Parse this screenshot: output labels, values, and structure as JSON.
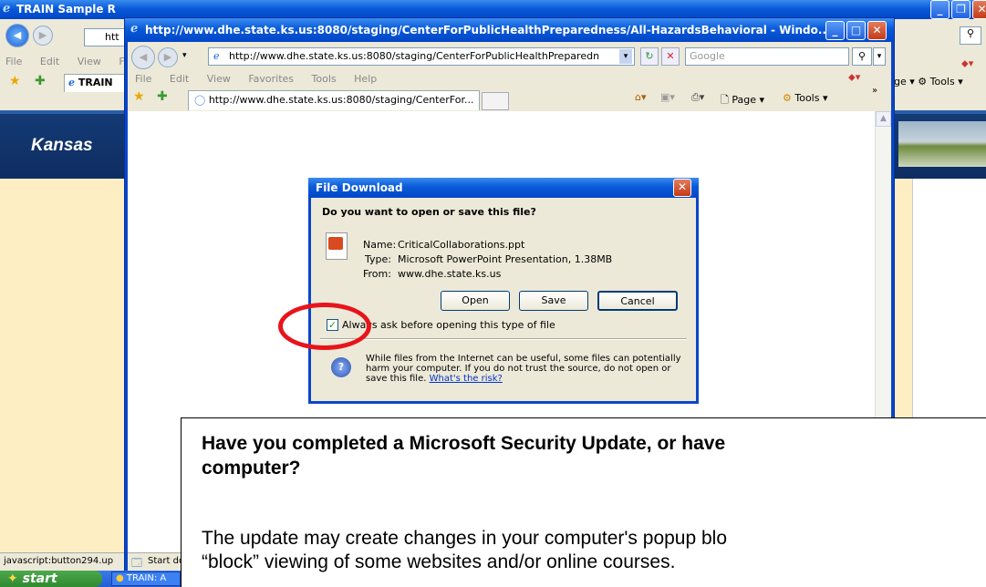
{
  "back_window": {
    "title": "TRAIN Sample R",
    "address_prefix": "htt",
    "menu_prefix": [
      "File",
      "Edit",
      "View",
      "F"
    ],
    "tab_label": "TRAIN",
    "right_toolbar": "ge ▾ ⚙ Tools ▾",
    "brand": "Kansas",
    "status_text": "javascript:button294.up"
  },
  "front_window": {
    "title": "http://www.dhe.state.ks.us:8080/staging/CenterForPublicHealthPreparedness/All-HazardsBehavioral - Windo...",
    "address": "http://www.dhe.state.ks.us:8080/staging/CenterForPublicHealthPreparedn",
    "search_placeholder": "Google",
    "menu": [
      "File",
      "Edit",
      "View",
      "Favorites",
      "Tools",
      "Help"
    ],
    "tab_label": "http://www.dhe.state.ks.us:8080/staging/CenterFor...",
    "command_bar": {
      "page": "Page ▾",
      "tools": "Tools ▾"
    },
    "status_text": "Start do"
  },
  "dialog": {
    "title": "File Download",
    "question": "Do you want to open or save this file?",
    "name_label": "Name:",
    "name_value": "CriticalCollaborations.ppt",
    "type_label": "Type:",
    "type_value": "Microsoft PowerPoint Presentation, 1.38MB",
    "from_label": "From:",
    "from_value": "www.dhe.state.ks.us",
    "open_label": "Open",
    "save_label": "Save",
    "cancel_label": "Cancel",
    "checkbox_label": "Always ask before opening this type of file",
    "checkbox_checked": true,
    "warning_text": "While files from the Internet can be useful, some files can potentially harm your computer. If you do not trust the source, do not open or save this file.",
    "risk_link": "What's the risk?"
  },
  "annotation": {
    "heading": "Have you completed a Microsoft Security Update, or have",
    "heading2": "computer?",
    "body": "The update may create changes in your computer's popup blo",
    "body2": "“block” viewing of some websites and/or online courses.",
    "highlight_color": "#e8141b"
  },
  "taskbar": {
    "start_label": "start",
    "task_label": "TRAIN: A"
  }
}
